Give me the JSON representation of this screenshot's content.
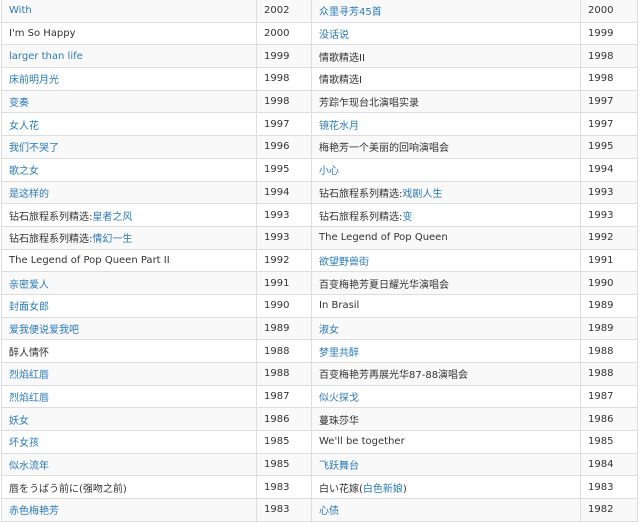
{
  "accent_color": "#2a7ab7",
  "rows": [
    {
      "left": {
        "pre": "",
        "link": "With",
        "post": ""
      },
      "left_year": "2002",
      "right": {
        "pre": "",
        "link": "众里寻芳45首",
        "post": ""
      },
      "right_year": "2000"
    },
    {
      "left": {
        "pre": "I'm So Happy",
        "link": "",
        "post": ""
      },
      "left_year": "2000",
      "right": {
        "pre": "",
        "link": "没话说",
        "post": ""
      },
      "right_year": "1999"
    },
    {
      "left": {
        "pre": "",
        "link": "larger than life",
        "post": ""
      },
      "left_year": "1999",
      "right": {
        "pre": "情歌精选II",
        "link": "",
        "post": ""
      },
      "right_year": "1998"
    },
    {
      "left": {
        "pre": "",
        "link": "床前明月光",
        "post": ""
      },
      "left_year": "1998",
      "right": {
        "pre": "情歌精选I",
        "link": "",
        "post": ""
      },
      "right_year": "1998"
    },
    {
      "left": {
        "pre": "",
        "link": "变奏",
        "post": ""
      },
      "left_year": "1998",
      "right": {
        "pre": "芳踪乍现台北演唱实录",
        "link": "",
        "post": ""
      },
      "right_year": "1997"
    },
    {
      "left": {
        "pre": "",
        "link": "女人花",
        "post": ""
      },
      "left_year": "1997",
      "right": {
        "pre": "",
        "link": "镜花水月",
        "post": ""
      },
      "right_year": "1997"
    },
    {
      "left": {
        "pre": "",
        "link": "我们不哭了",
        "post": ""
      },
      "left_year": "1996",
      "right": {
        "pre": "梅艳芳一个美丽的回响演唱会",
        "link": "",
        "post": ""
      },
      "right_year": "1995"
    },
    {
      "left": {
        "pre": "",
        "link": "歌之女",
        "post": ""
      },
      "left_year": "1995",
      "right": {
        "pre": "",
        "link": "小心",
        "post": ""
      },
      "right_year": "1994"
    },
    {
      "left": {
        "pre": "",
        "link": "是这样的",
        "post": ""
      },
      "left_year": "1994",
      "right": {
        "pre": "钻石旅程系列精选:",
        "link": "戏剧人生",
        "post": ""
      },
      "right_year": "1993"
    },
    {
      "left": {
        "pre": "钻石旅程系列精选:",
        "link": "皇者之风",
        "post": ""
      },
      "left_year": "1993",
      "right": {
        "pre": "钻石旅程系列精选:",
        "link": "变",
        "post": ""
      },
      "right_year": "1993"
    },
    {
      "left": {
        "pre": "钻石旅程系列精选:",
        "link": "情幻一生",
        "post": ""
      },
      "left_year": "1993",
      "right": {
        "pre": "The Legend of Pop Queen",
        "link": "",
        "post": ""
      },
      "right_year": "1992"
    },
    {
      "left": {
        "pre": "The Legend of  Pop Queen Part II",
        "link": "",
        "post": ""
      },
      "left_year": "1992",
      "right": {
        "pre": "",
        "link": "欲望野兽街",
        "post": ""
      },
      "right_year": "1991"
    },
    {
      "left": {
        "pre": "",
        "link": "亲密爱人",
        "post": ""
      },
      "left_year": "1991",
      "right": {
        "pre": "百变梅艳芳夏日耀光华演唱会",
        "link": "",
        "post": ""
      },
      "right_year": "1990"
    },
    {
      "left": {
        "pre": "",
        "link": "封面女郎",
        "post": ""
      },
      "left_year": "1990",
      "right": {
        "pre": "In Brasil",
        "link": "",
        "post": ""
      },
      "right_year": "1989"
    },
    {
      "left": {
        "pre": "",
        "link": "爱我便说爱我吧",
        "post": ""
      },
      "left_year": "1989",
      "right": {
        "pre": "",
        "link": "淑女",
        "post": ""
      },
      "right_year": "1989"
    },
    {
      "left": {
        "pre": "醉人情怀",
        "link": "",
        "post": ""
      },
      "left_year": "1988",
      "right": {
        "pre": "",
        "link": "梦里共醉",
        "post": ""
      },
      "right_year": "1988"
    },
    {
      "left": {
        "pre": "",
        "link": "烈焰红唇",
        "post": ""
      },
      "left_year": "1988",
      "right": {
        "pre": "百变梅艳芳再展光华87-88演唱会",
        "link": "",
        "post": ""
      },
      "right_year": "1988"
    },
    {
      "left": {
        "pre": "",
        "link": "烈焰红唇",
        "post": ""
      },
      "left_year": "1987",
      "right": {
        "pre": "",
        "link": "似火探戈",
        "post": ""
      },
      "right_year": "1987"
    },
    {
      "left": {
        "pre": "",
        "link": "妖女",
        "post": ""
      },
      "left_year": "1986",
      "right": {
        "pre": "蔓珠莎华",
        "link": "",
        "post": ""
      },
      "right_year": "1986"
    },
    {
      "left": {
        "pre": "",
        "link": "坏女孩",
        "post": ""
      },
      "left_year": "1985",
      "right": {
        "pre": "We'll be together",
        "link": "",
        "post": ""
      },
      "right_year": "1985"
    },
    {
      "left": {
        "pre": "",
        "link": "似水流年",
        "post": ""
      },
      "left_year": "1985",
      "right": {
        "pre": "",
        "link": "飞跃舞台",
        "post": ""
      },
      "right_year": "1984"
    },
    {
      "left": {
        "pre": "唇をうばう前に(强吻之前)",
        "link": "",
        "post": ""
      },
      "left_year": "1983",
      "right": {
        "pre": "白い花嫁(",
        "link": "白色新娘",
        "post": ")"
      },
      "right_year": "1983"
    },
    {
      "left": {
        "pre": "",
        "link": "赤色梅艳芳",
        "post": ""
      },
      "left_year": "1983",
      "right": {
        "pre": "",
        "link": "心债",
        "post": ""
      },
      "right_year": "1982"
    }
  ]
}
